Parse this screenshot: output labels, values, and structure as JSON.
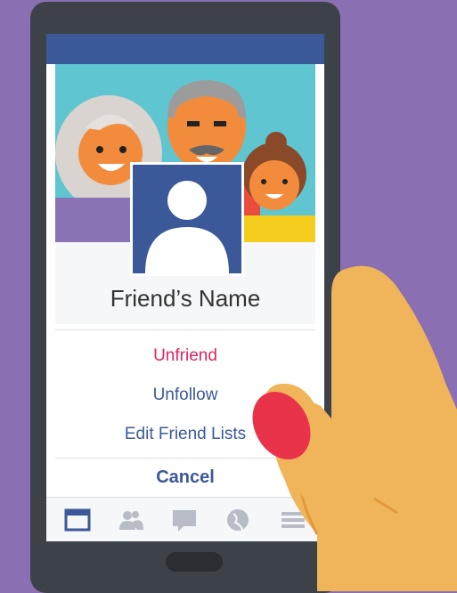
{
  "profile": {
    "name": "Friend’s Name"
  },
  "menu": {
    "unfriend": "Unfriend",
    "unfollow": "Unfollow",
    "edit_lists": "Edit Friend Lists",
    "cancel": "Cancel"
  },
  "colors": {
    "brand": "#3b5998",
    "danger": "#e0245e",
    "background": "#8a6fb3"
  },
  "nav": {
    "items": [
      "news-feed-icon",
      "friends-icon",
      "messages-icon",
      "globe-icon",
      "menu-icon"
    ],
    "active": "news-feed-icon"
  }
}
